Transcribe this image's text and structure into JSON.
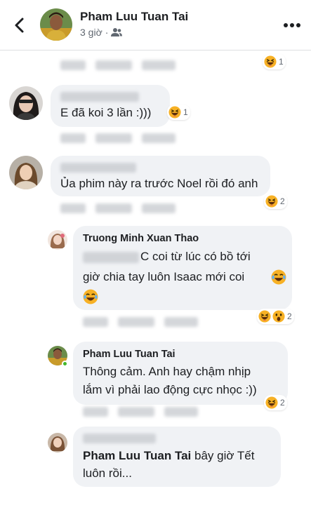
{
  "header": {
    "title": "Pham Luu Tuan Tai",
    "time": "3 giờ",
    "dot": "·"
  },
  "comments": [
    {
      "author": "",
      "text": "E đã koi 3 lần :)))",
      "reaction_count": "1"
    },
    {
      "author": "",
      "text": "Ủa phim này ra trước Noel rồi đó anh",
      "reaction_count": "2"
    }
  ],
  "replies": [
    {
      "author": "Truong Minh Xuan Thao",
      "text_line1": "C coi từ lúc có bồ tới",
      "text_line2": "giờ chia tay luôn Isaac mới coi",
      "reaction_count": "2"
    },
    {
      "author": "Pham Luu Tuan Tai",
      "text_line1": "Thông cảm. Anh hay chậm nhịp",
      "text_line2": "lắm vì phải lao động cực nhọc :))",
      "reaction_count": "2"
    },
    {
      "author": "",
      "mention": "Pham Luu Tuan Tai",
      "text_line1": " bây giờ Tết",
      "text_line2": "luôn rồi..."
    }
  ],
  "top_reaction_count": "1",
  "icons": [
    "back-icon",
    "friends-icon",
    "more-icon",
    "haha-emoji",
    "wow-emoji"
  ],
  "colors": {
    "bubble": "#f0f2f5",
    "meta": "#606770",
    "online": "#42b72a",
    "emoji": "#f7b125"
  }
}
